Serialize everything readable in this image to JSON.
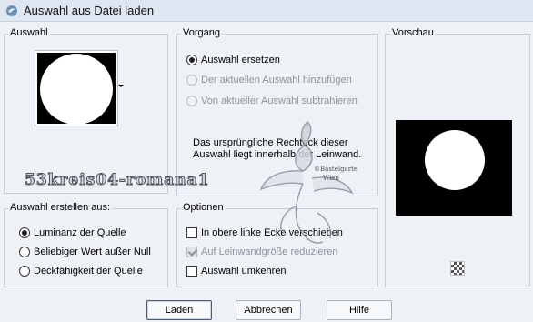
{
  "window": {
    "title": "Auswahl aus Datei laden"
  },
  "auswahl": {
    "label": "Auswahl"
  },
  "vorgang": {
    "label": "Vorgang",
    "options": [
      {
        "label": "Auswahl ersetzen",
        "checked": true,
        "enabled": true
      },
      {
        "label": "Der aktuellen Auswahl hinzufügen",
        "checked": false,
        "enabled": false
      },
      {
        "label": "Von aktueller Auswahl subtrahieren",
        "checked": false,
        "enabled": false
      }
    ],
    "info_text": "Das ursprüngliche Rechteck dieser Auswahl liegt innerhalb der Leinwand."
  },
  "vorschau": {
    "label": "Vorschau"
  },
  "erstellen": {
    "label": "Auswahl erstellen aus:",
    "options": [
      {
        "label": "Luminanz der Quelle",
        "checked": true
      },
      {
        "label": "Beliebiger Wert außer Null",
        "checked": false
      },
      {
        "label": "Deckfähigkeit der Quelle",
        "checked": false
      }
    ]
  },
  "optionen": {
    "label": "Optionen",
    "options": [
      {
        "label": "In obere linke Ecke verschieben",
        "checked": false,
        "enabled": true
      },
      {
        "label": "Auf Leinwandgröße reduzieren",
        "checked": true,
        "enabled": false
      },
      {
        "label": "Auswahl umkehren",
        "checked": false,
        "enabled": true
      }
    ]
  },
  "buttons": {
    "load": "Laden",
    "cancel": "Abbrechen",
    "help": "Hilfe"
  },
  "watermark": {
    "name": "53kreis04-romana1",
    "logo_line1": "©Bastelgarten",
    "logo_line2": "Wien"
  },
  "colors": {
    "titlebar": "#dde6f1",
    "dialog_bg": "#eef1f6",
    "group_border": "#c5cdd8",
    "disabled_text": "#8d939b"
  }
}
